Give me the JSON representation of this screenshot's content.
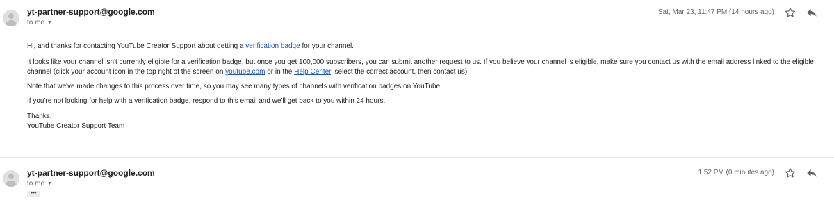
{
  "messages": [
    {
      "sender": "yt-partner-support@google.com",
      "to": "to me",
      "time": "Sat, Mar 23, 11:47 PM (14 hours ago)",
      "body": {
        "p1_pre": "Hi, and thanks for contacting YouTube Creator Support about getting a ",
        "p1_link": "verification badge",
        "p1_post": " for your channel.",
        "p2_pre": "It looks like your channel isn't currently eligible for a verification badge, but once you get 100,000 subscribers, you can submit another request to us. If you believe your channel is eligible, make sure you contact us with the email address linked to the eligible channel (click your account icon in the top right of the screen on ",
        "p2_link1": "youtube.com",
        "p2_mid": " or in the ",
        "p2_link2": "Help Center",
        "p2_post": ", select the correct account, then contact us).",
        "p3": "Note that we've made changes to this process over time, so you may see many types of channels with verification badges on YouTube.",
        "p4": "If you're not looking for help with a verification badge, respond to this email and we'll get back to you within 24 hours.",
        "sign1": "Thanks,",
        "sign2": "YouTube Creator Support Team"
      }
    },
    {
      "sender": "yt-partner-support@google.com",
      "to": "to me",
      "time": "1:52 PM (0 minutes ago)",
      "collapsed": "•••"
    }
  ],
  "icons": {
    "avatar": "avatar-icon",
    "star": "star-icon",
    "reply": "reply-icon",
    "dropdown": "chevron-down-icon"
  },
  "colors": {
    "link": "#1a56c7",
    "meta": "#5f6368",
    "text": "#222222"
  }
}
